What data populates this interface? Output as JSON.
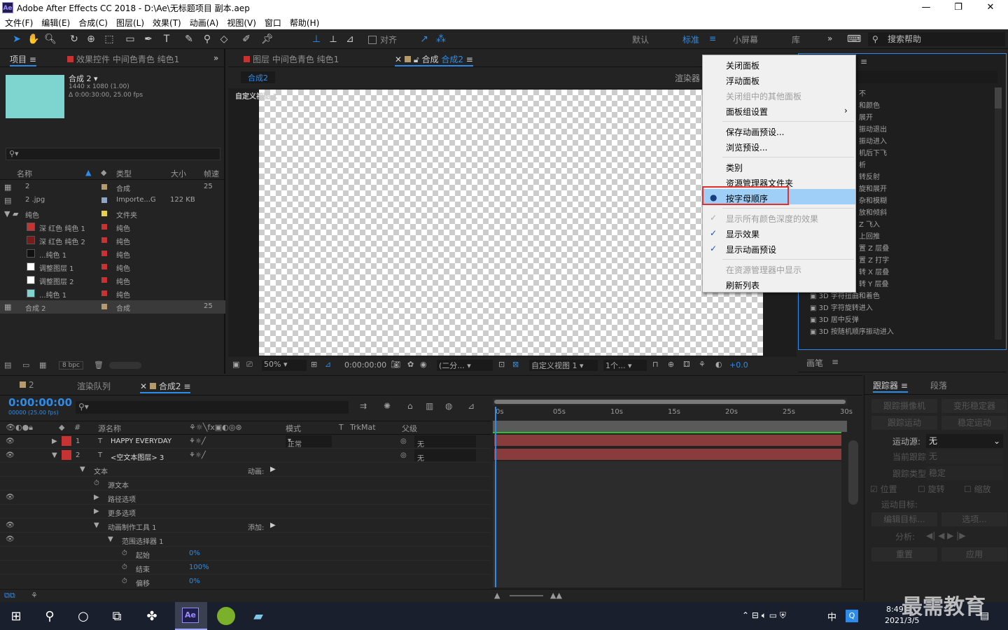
{
  "window": {
    "title": "Adobe After Effects CC 2018 - D:\\Ae\\无标题项目 副本.aep",
    "app_icon": "Ae"
  },
  "menubar": [
    "文件(F)",
    "编辑(E)",
    "合成(C)",
    "图层(L)",
    "效果(T)",
    "动画(A)",
    "视图(V)",
    "窗口",
    "帮助(H)"
  ],
  "toolbar": {
    "snap_label": "对齐",
    "workspaces": [
      "默认",
      "标准",
      "小屏幕",
      "库"
    ],
    "search_placeholder": "搜索帮助"
  },
  "project": {
    "tab_project": "项目",
    "tab_effects": "效果控件 中间色青色 纯色1",
    "comp_name": "合成 2 ▾",
    "comp_size": "1440 x 1080 (1.00)",
    "comp_duration": "Δ 0:00:30:00, 25.00 fps",
    "columns": [
      "名称",
      "类型",
      "大小",
      "帧速"
    ],
    "rows": [
      {
        "name": "2",
        "type": "合成",
        "size": "",
        "fps": "25",
        "color": "#b49a6d"
      },
      {
        "name": "2 .jpg",
        "type": "Importe...G",
        "size": "122 KB",
        "fps": "",
        "color": "#8fa5c8"
      },
      {
        "name": "纯色",
        "type": "文件夹",
        "size": "",
        "fps": "",
        "color": "#e7d14b"
      },
      {
        "name": "深 红色 纯色 1",
        "type": "纯色",
        "size": "",
        "fps": "",
        "color": "#c83232"
      },
      {
        "name": "深 红色 纯色 2",
        "type": "纯色",
        "size": "",
        "fps": "",
        "color": "#c83232"
      },
      {
        "name": "...纯色 1",
        "type": "纯色",
        "size": "",
        "fps": "",
        "color": "#c83232"
      },
      {
        "name": "调整图层 1",
        "type": "纯色",
        "size": "",
        "fps": "",
        "color": "#c83232"
      },
      {
        "name": "调整图层 2",
        "type": "纯色",
        "size": "",
        "fps": "",
        "color": "#c83232"
      },
      {
        "name": "...纯色 1",
        "type": "纯色",
        "size": "",
        "fps": "",
        "color": "#c83232"
      },
      {
        "name": "合成 2",
        "type": "合成",
        "size": "",
        "fps": "25",
        "color": "#b49a6d"
      }
    ],
    "bpc": "8 bpc"
  },
  "viewer": {
    "tab_layer": "图层 中间色青色 纯色1",
    "tab_comp_prefix": "合成",
    "tab_comp": "合成2",
    "sub_tab": "合成2",
    "renderer": "渲染器",
    "view_label": "自定义视图 1",
    "zoom": "50%",
    "timecode": "0:00:00:00",
    "resolution": "(二分...",
    "view_select": "自定义视图 1",
    "views": "1个...",
    "exposure": "+0.0"
  },
  "effects_list": [
    "不",
    "和颜色",
    "展开",
    "振动退出",
    "振动进入",
    "机后下飞",
    "析",
    "转反射",
    "旋和展开",
    "杂和模糊",
    "放和倾斜",
    "Z 飞入",
    "上回推",
    "置 Z 层叠",
    "置 Z 打字",
    "转 X 层叠",
    "转 Y 层叠",
    "3D 字符扭曲和着色",
    "3D 字符旋转进入",
    "3D 居中反弹",
    "3D 按随机顺序振动进入"
  ],
  "context_menu": {
    "items": [
      {
        "label": "关闭面板",
        "disabled": false,
        "check": ""
      },
      {
        "label": "浮动面板",
        "disabled": false,
        "check": ""
      },
      {
        "label": "关闭组中的其他面板",
        "disabled": true,
        "check": ""
      },
      {
        "label": "面板组设置",
        "disabled": false,
        "check": "",
        "submenu": "›"
      },
      {
        "label": "保存动画预设...",
        "disabled": false,
        "check": ""
      },
      {
        "label": "浏览预设...",
        "disabled": false,
        "check": ""
      },
      {
        "label": "类别",
        "disabled": false,
        "check": ""
      },
      {
        "label": "资源管理器文件夹",
        "disabled": false,
        "check": ""
      },
      {
        "label": "按字母顺序",
        "disabled": false,
        "check": "●"
      },
      {
        "label": "显示所有颜色深度的效果",
        "disabled": true,
        "check": "✓"
      },
      {
        "label": "显示效果",
        "disabled": false,
        "check": "✓"
      },
      {
        "label": "显示动画预设",
        "disabled": false,
        "check": "✓"
      },
      {
        "label": "在资源管理器中显示",
        "disabled": true,
        "check": ""
      },
      {
        "label": "刷新列表",
        "disabled": false,
        "check": ""
      }
    ]
  },
  "brush_panel": "画笔",
  "timeline": {
    "tabs": [
      "2",
      "渲染队列",
      "合成2"
    ],
    "timecode": "0:00:00:00",
    "timecode_sub": "00000 (25.00 fps)",
    "headers": {
      "source": "源名称",
      "mode": "模式",
      "t": "T",
      "trkmat": "TrkMat",
      "parent": "父级"
    },
    "ruler": [
      "0s",
      "05s",
      "10s",
      "15s",
      "20s",
      "25s",
      "30s"
    ],
    "layers": [
      {
        "num": "1",
        "name": "HAPPY EVERYDAY",
        "mode": "正常",
        "parent": "无"
      },
      {
        "num": "2",
        "name": "<空文本图层> 3",
        "mode": "",
        "parent": "无"
      }
    ],
    "props": [
      {
        "label": "文本",
        "indent": 1,
        "extra": "动画:"
      },
      {
        "label": "源文本",
        "indent": 2,
        "extra": ""
      },
      {
        "label": "路径选项",
        "indent": 2,
        "extra": ""
      },
      {
        "label": "更多选项",
        "indent": 2,
        "extra": ""
      },
      {
        "label": "动画制作工具 1",
        "indent": 2,
        "extra": "添加:"
      },
      {
        "label": "范围选择器 1",
        "indent": 3,
        "extra": ""
      },
      {
        "label": "起始",
        "indent": 4,
        "value": "0%"
      },
      {
        "label": "结束",
        "indent": 4,
        "value": "100%"
      },
      {
        "label": "偏移",
        "indent": 4,
        "value": "0%"
      }
    ]
  },
  "tracker": {
    "tab": "跟踪器",
    "tab2": "段落",
    "btn_camera": "跟踪摄像机",
    "btn_warp": "变形稳定器",
    "btn_motion": "跟踪运动",
    "btn_stabilize": "稳定运动",
    "source_label": "运动源:",
    "source_value": "无",
    "current_label": "当前跟踪:",
    "type_label": "跟踪类型:",
    "type_value": "稳定",
    "pos": "位置",
    "rot": "旋转",
    "scale": "缩放",
    "target_label": "运动目标:",
    "edit_target": "编辑目标...",
    "options": "选项...",
    "analyze": "分析:",
    "reset": "重置",
    "apply": "应用"
  },
  "taskbar": {
    "time": "8:49",
    "date": "2021/3/5",
    "ime": "中",
    "watermark": "最需教育"
  }
}
